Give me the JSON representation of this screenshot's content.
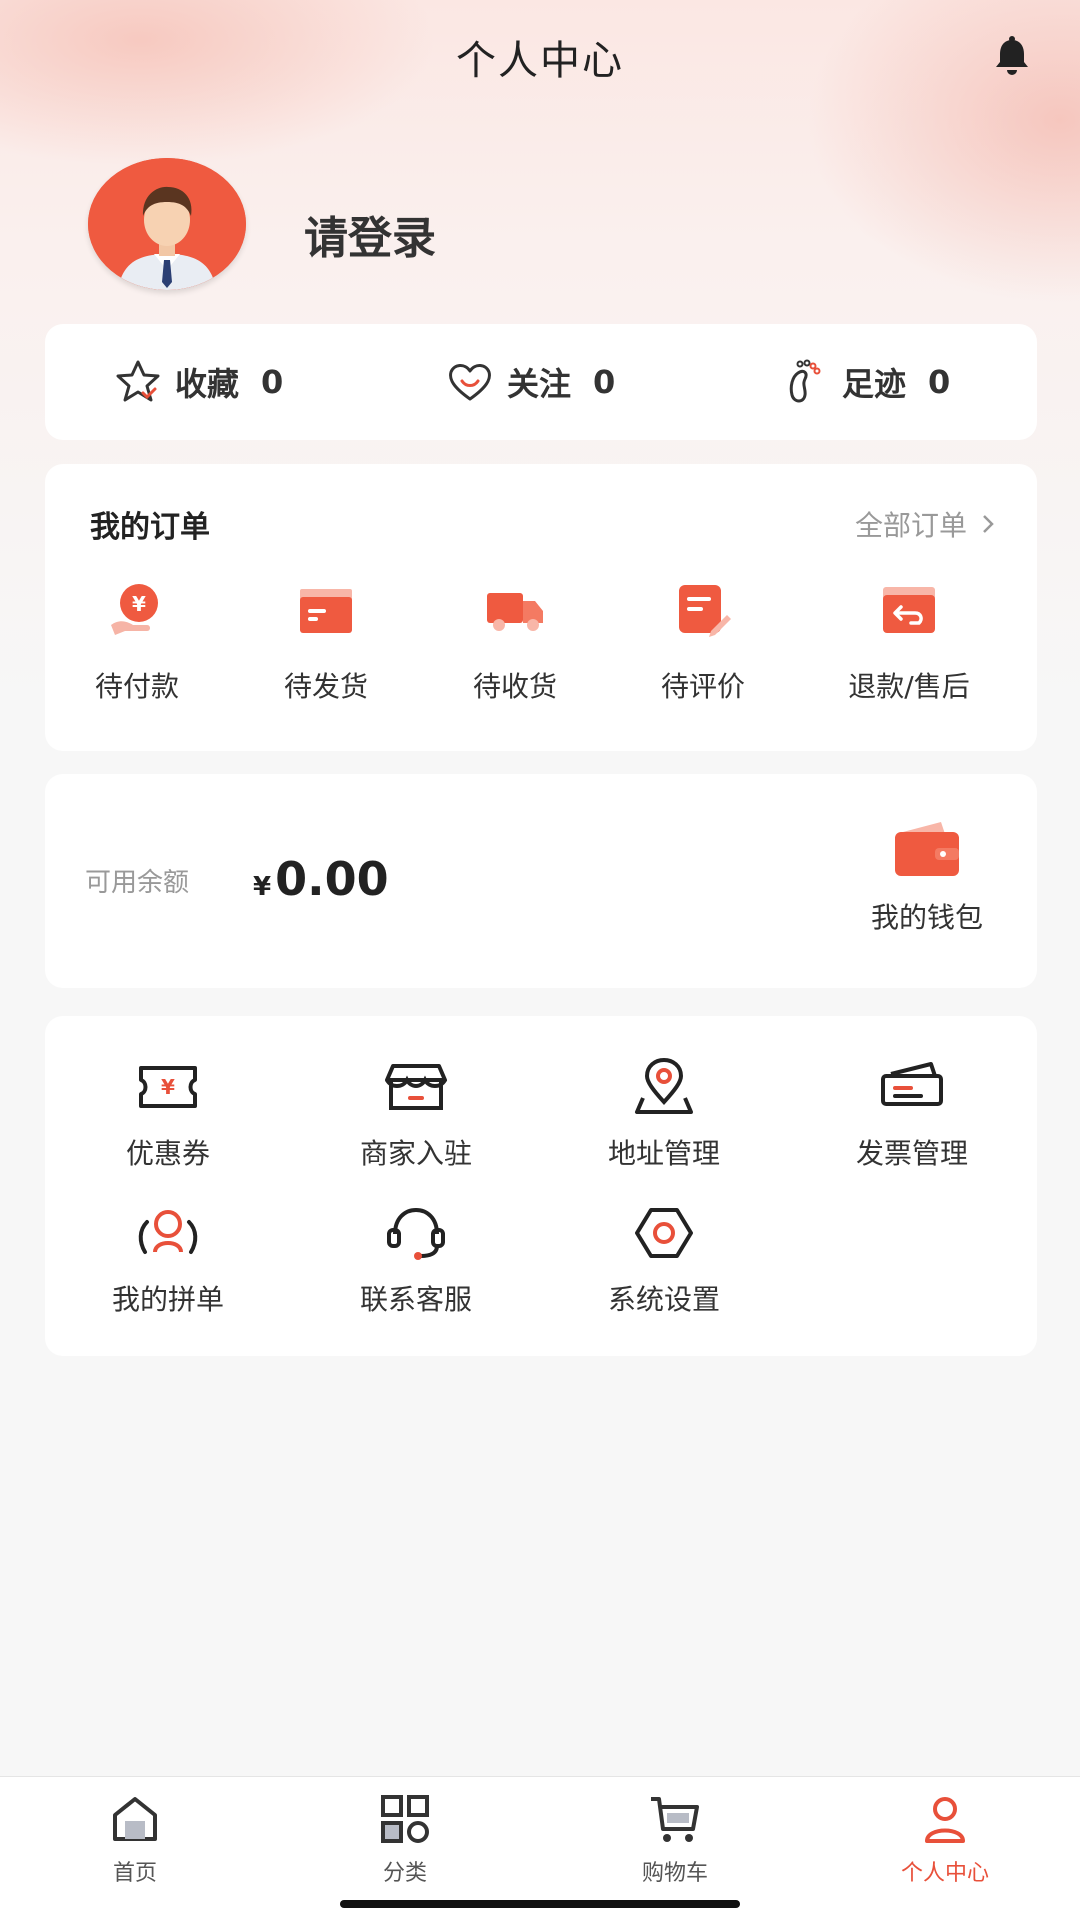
{
  "header": {
    "title": "个人中心",
    "bell_icon": "bell-icon"
  },
  "profile": {
    "login_text": "请登录",
    "avatar_icon": "user-avatar-icon"
  },
  "stats": [
    {
      "label": "收藏",
      "count": "0",
      "icon": "star-icon"
    },
    {
      "label": "关注",
      "count": "0",
      "icon": "heart-icon"
    },
    {
      "label": "足迹",
      "count": "0",
      "icon": "footprint-icon"
    }
  ],
  "orders": {
    "title": "我的订单",
    "all_label": "全部订单",
    "items": [
      {
        "label": "待付款",
        "icon": "pending-payment-icon"
      },
      {
        "label": "待发货",
        "icon": "pending-shipment-icon"
      },
      {
        "label": "待收货",
        "icon": "delivery-truck-icon"
      },
      {
        "label": "待评价",
        "icon": "review-icon"
      },
      {
        "label": "退款/售后",
        "icon": "refund-icon"
      }
    ]
  },
  "wallet": {
    "balance_label": "可用余额",
    "currency": "¥",
    "amount": "0.00",
    "link_label": "我的钱包",
    "icon": "wallet-icon"
  },
  "services": [
    {
      "label": "优惠券",
      "icon": "coupon-icon"
    },
    {
      "label": "商家入驻",
      "icon": "store-icon"
    },
    {
      "label": "地址管理",
      "icon": "location-pin-icon"
    },
    {
      "label": "发票管理",
      "icon": "invoice-icon"
    },
    {
      "label": "我的拼单",
      "icon": "group-buy-icon"
    },
    {
      "label": "联系客服",
      "icon": "headset-icon"
    },
    {
      "label": "系统设置",
      "icon": "settings-hexagon-icon"
    }
  ],
  "tabbar": {
    "active": "个人中心",
    "items": [
      {
        "label": "首页",
        "icon": "home-icon"
      },
      {
        "label": "分类",
        "icon": "category-grid-icon"
      },
      {
        "label": "购物车",
        "icon": "cart-icon"
      },
      {
        "label": "个人中心",
        "icon": "profile-icon"
      }
    ]
  },
  "colors": {
    "accent": "#e8503a",
    "avatar_bg": "#ef5a40",
    "page_bg": "#f7f7f7"
  }
}
